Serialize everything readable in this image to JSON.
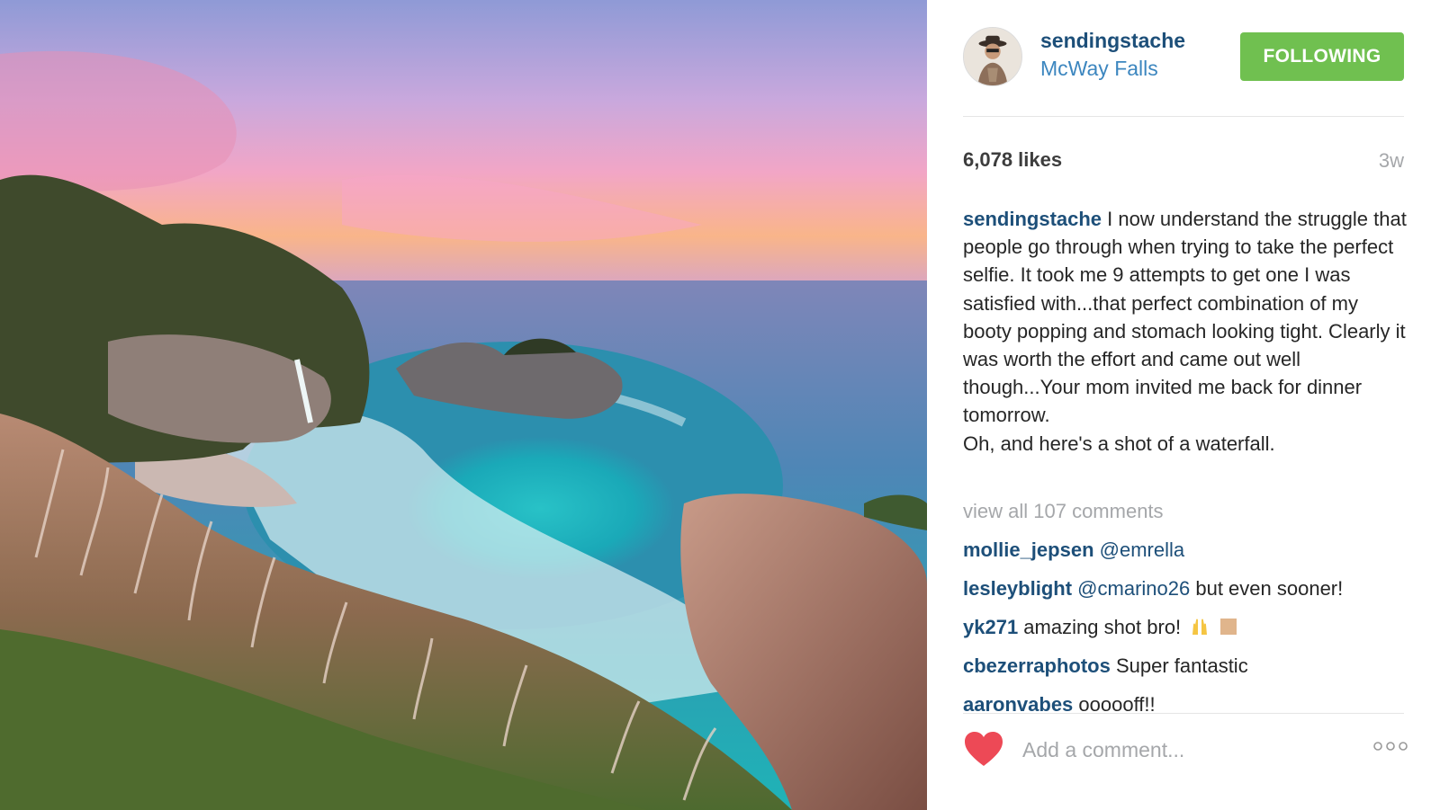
{
  "post": {
    "username": "sendingstache",
    "location": "McWay Falls",
    "follow_label": "FOLLOWING",
    "likes": "6,078 likes",
    "age": "3w",
    "caption_author": "sendingstache",
    "caption_text": "I now understand the struggle that people go through when trying to take the perfect selfie. It took me 9 attempts to get one I was satisfied with...that perfect combination of my booty popping and stomach looking tight. Clearly it was worth the effort and came out well though...Your mom invited me back for dinner tomorrow.\nOh, and here's a shot of a waterfall.",
    "view_all_label": "view all 107 comments",
    "comment_placeholder": "Add a comment..."
  },
  "comments": [
    {
      "user": "mollie_jepsen",
      "mention": "@emrella",
      "text": ""
    },
    {
      "user": "lesleyblight",
      "mention": "@cmarino26",
      "text": " but even sooner!"
    },
    {
      "user": "yk271",
      "mention": "",
      "text": " amazing shot bro!"
    },
    {
      "user": "cbezerraphotos",
      "mention": "",
      "text": " Super fantastic"
    },
    {
      "user": "aaronvabes",
      "mention": "",
      "text": " oooooff!!"
    }
  ],
  "icons": {
    "like": "heart-icon",
    "more": "more-options-icon",
    "emoji_1": "raised-hands-emoji",
    "emoji_2": "skin-tone-emoji"
  },
  "colors": {
    "username": "#1d4f79",
    "location": "#3c86bf",
    "follow_button": "#70c050",
    "heart": "#ed4956",
    "muted": "#a5a7aa"
  }
}
